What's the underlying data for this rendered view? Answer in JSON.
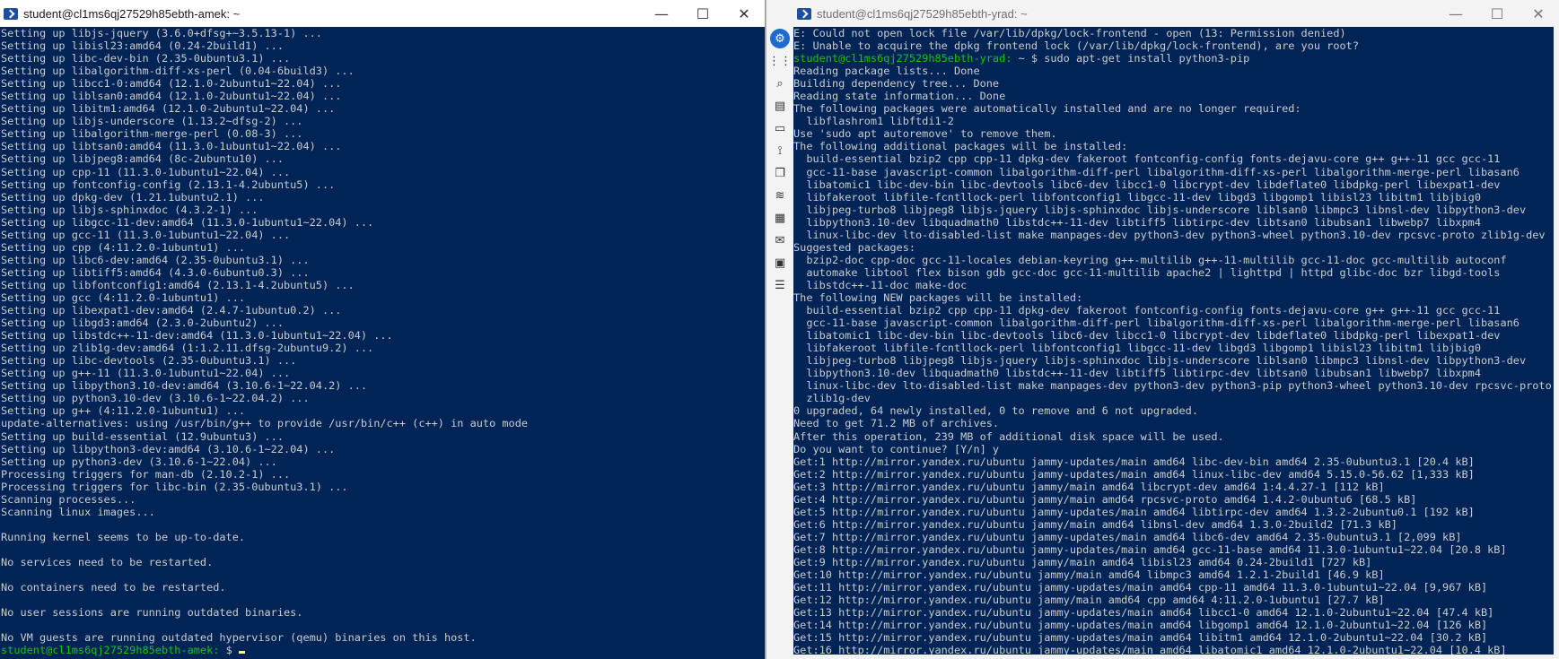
{
  "left_window": {
    "title": "student@cl1ms6qj27529h85ebth-amek: ~",
    "controls": {
      "minimize": "—",
      "maximize": "☐",
      "close": "✕"
    },
    "lines": [
      "Setting up libjs-jquery (3.6.0+dfsg+~3.5.13-1) ...",
      "Setting up libisl23:amd64 (0.24-2build1) ...",
      "Setting up libc-dev-bin (2.35-0ubuntu3.1) ...",
      "Setting up libalgorithm-diff-xs-perl (0.04-6build3) ...",
      "Setting up libcc1-0:amd64 (12.1.0-2ubuntu1~22.04) ...",
      "Setting up liblsan0:amd64 (12.1.0-2ubuntu1~22.04) ...",
      "Setting up libitm1:amd64 (12.1.0-2ubuntu1~22.04) ...",
      "Setting up libjs-underscore (1.13.2~dfsg-2) ...",
      "Setting up libalgorithm-merge-perl (0.08-3) ...",
      "Setting up libtsan0:amd64 (11.3.0-1ubuntu1~22.04) ...",
      "Setting up libjpeg8:amd64 (8c-2ubuntu10) ...",
      "Setting up cpp-11 (11.3.0-1ubuntu1~22.04) ...",
      "Setting up fontconfig-config (2.13.1-4.2ubuntu5) ...",
      "Setting up dpkg-dev (1.21.1ubuntu2.1) ...",
      "Setting up libjs-sphinxdoc (4.3.2-1) ...",
      "Setting up libgcc-11-dev:amd64 (11.3.0-1ubuntu1~22.04) ...",
      "Setting up gcc-11 (11.3.0-1ubuntu1~22.04) ...",
      "Setting up cpp (4:11.2.0-1ubuntu1) ...",
      "Setting up libc6-dev:amd64 (2.35-0ubuntu3.1) ...",
      "Setting up libtiff5:amd64 (4.3.0-6ubuntu0.3) ...",
      "Setting up libfontconfig1:amd64 (2.13.1-4.2ubuntu5) ...",
      "Setting up gcc (4:11.2.0-1ubuntu1) ...",
      "Setting up libexpat1-dev:amd64 (2.4.7-1ubuntu0.2) ...",
      "Setting up libgd3:amd64 (2.3.0-2ubuntu2) ...",
      "Setting up libstdc++-11-dev:amd64 (11.3.0-1ubuntu1~22.04) ...",
      "Setting up zlib1g-dev:amd64 (1:1.2.11.dfsg-2ubuntu9.2) ...",
      "Setting up libc-devtools (2.35-0ubuntu3.1) ...",
      "Setting up g++-11 (11.3.0-1ubuntu1~22.04) ...",
      "Setting up libpython3.10-dev:amd64 (3.10.6-1~22.04.2) ...",
      "Setting up python3.10-dev (3.10.6-1~22.04.2) ...",
      "Setting up g++ (4:11.2.0-1ubuntu1) ...",
      "update-alternatives: using /usr/bin/g++ to provide /usr/bin/c++ (c++) in auto mode",
      "Setting up build-essential (12.9ubuntu3) ...",
      "Setting up libpython3-dev:amd64 (3.10.6-1~22.04) ...",
      "Setting up python3-dev (3.10.6-1~22.04) ...",
      "Processing triggers for man-db (2.10.2-1) ...",
      "Processing triggers for libc-bin (2.35-0ubuntu3.1) ...",
      "Scanning processes...",
      "Scanning linux images...",
      "",
      "Running kernel seems to be up-to-date.",
      "",
      "No services need to be restarted.",
      "",
      "No containers need to be restarted.",
      "",
      "No user sessions are running outdated binaries.",
      "",
      "No VM guests are running outdated hypervisor (qemu) binaries on this host."
    ],
    "prompt": "student@cl1ms6qj27529h85ebth-amek:",
    "prompt_suffix": " $ "
  },
  "right_window": {
    "title": "student@cl1ms6qj27529h85ebth-yrad: ~",
    "controls": {
      "minimize": "—",
      "maximize": "☐",
      "close": "✕"
    },
    "toolbar_icons": [
      "settings-icon",
      "apps-grid-icon",
      "search-icon",
      "server-icon",
      "drive-icon",
      "network-icon",
      "copy-icon",
      "layers-icon",
      "dashboard-icon",
      "chat-icon",
      "image-icon",
      "list-icon"
    ],
    "toolbar_glyphs": [
      "⚙",
      "⋮⋮",
      "⌕",
      "▤",
      "▭",
      "⟟",
      "❐",
      "≋",
      "▦",
      "✉",
      "▣",
      "☰"
    ],
    "prompt": "student@cl1ms6qj27529h85ebth-yrad:",
    "prompt_command": " ~ $ sudo apt-get install python3-pip",
    "lines_before": [
      "E: Could not open lock file /var/lib/dpkg/lock-frontend - open (13: Permission denied)",
      "E: Unable to acquire the dpkg frontend lock (/var/lib/dpkg/lock-frontend), are you root?"
    ],
    "lines_after": [
      "Reading package lists... Done",
      "Building dependency tree... Done",
      "Reading state information... Done",
      "The following packages were automatically installed and are no longer required:",
      "  libflashrom1 libftdi1-2",
      "Use 'sudo apt autoremove' to remove them.",
      "The following additional packages will be installed:",
      "  build-essential bzip2 cpp cpp-11 dpkg-dev fakeroot fontconfig-config fonts-dejavu-core g++ g++-11 gcc gcc-11",
      "  gcc-11-base javascript-common libalgorithm-diff-perl libalgorithm-diff-xs-perl libalgorithm-merge-perl libasan6",
      "  libatomic1 libc-dev-bin libc-devtools libc6-dev libcc1-0 libcrypt-dev libdeflate0 libdpkg-perl libexpat1-dev",
      "  libfakeroot libfile-fcntllock-perl libfontconfig1 libgcc-11-dev libgd3 libgomp1 libisl23 libitm1 libjbig0",
      "  libjpeg-turbo8 libjpeg8 libjs-jquery libjs-sphinxdoc libjs-underscore liblsan0 libmpc3 libnsl-dev libpython3-dev",
      "  libpython3.10-dev libquadmath0 libstdc++-11-dev libtiff5 libtirpc-dev libtsan0 libubsan1 libwebp7 libxpm4",
      "  linux-libc-dev lto-disabled-list make manpages-dev python3-dev python3-wheel python3.10-dev rpcsvc-proto zlib1g-dev",
      "Suggested packages:",
      "  bzip2-doc cpp-doc gcc-11-locales debian-keyring g++-multilib g++-11-multilib gcc-11-doc gcc-multilib autoconf",
      "  automake libtool flex bison gdb gcc-doc gcc-11-multilib apache2 | lighttpd | httpd glibc-doc bzr libgd-tools",
      "  libstdc++-11-doc make-doc",
      "The following NEW packages will be installed:",
      "  build-essential bzip2 cpp cpp-11 dpkg-dev fakeroot fontconfig-config fonts-dejavu-core g++ g++-11 gcc gcc-11",
      "  gcc-11-base javascript-common libalgorithm-diff-perl libalgorithm-diff-xs-perl libalgorithm-merge-perl libasan6",
      "  libatomic1 libc-dev-bin libc-devtools libc6-dev libcc1-0 libcrypt-dev libdeflate0 libdpkg-perl libexpat1-dev",
      "  libfakeroot libfile-fcntllock-perl libfontconfig1 libgcc-11-dev libgd3 libgomp1 libisl23 libitm1 libjbig0",
      "  libjpeg-turbo8 libjpeg8 libjs-jquery libjs-sphinxdoc libjs-underscore liblsan0 libmpc3 libnsl-dev libpython3-dev",
      "  libpython3.10-dev libquadmath0 libstdc++-11-dev libtiff5 libtirpc-dev libtsan0 libubsan1 libwebp7 libxpm4",
      "  linux-libc-dev lto-disabled-list make manpages-dev python3-dev python3-pip python3-wheel python3.10-dev rpcsvc-proto",
      "  zlib1g-dev",
      "0 upgraded, 64 newly installed, 0 to remove and 6 not upgraded.",
      "Need to get 71.2 MB of archives.",
      "After this operation, 239 MB of additional disk space will be used.",
      "Do you want to continue? [Y/n] y",
      "Get:1 http://mirror.yandex.ru/ubuntu jammy-updates/main amd64 libc-dev-bin amd64 2.35-0ubuntu3.1 [20.4 kB]",
      "Get:2 http://mirror.yandex.ru/ubuntu jammy-updates/main amd64 linux-libc-dev amd64 5.15.0-56.62 [1,333 kB]",
      "Get:3 http://mirror.yandex.ru/ubuntu jammy/main amd64 libcrypt-dev amd64 1:4.4.27-1 [112 kB]",
      "Get:4 http://mirror.yandex.ru/ubuntu jammy/main amd64 rpcsvc-proto amd64 1.4.2-0ubuntu6 [68.5 kB]",
      "Get:5 http://mirror.yandex.ru/ubuntu jammy-updates/main amd64 libtirpc-dev amd64 1.3.2-2ubuntu0.1 [192 kB]",
      "Get:6 http://mirror.yandex.ru/ubuntu jammy/main amd64 libnsl-dev amd64 1.3.0-2build2 [71.3 kB]",
      "Get:7 http://mirror.yandex.ru/ubuntu jammy-updates/main amd64 libc6-dev amd64 2.35-0ubuntu3.1 [2,099 kB]",
      "Get:8 http://mirror.yandex.ru/ubuntu jammy-updates/main amd64 gcc-11-base amd64 11.3.0-1ubuntu1~22.04 [20.8 kB]",
      "Get:9 http://mirror.yandex.ru/ubuntu jammy/main amd64 libisl23 amd64 0.24-2build1 [727 kB]",
      "Get:10 http://mirror.yandex.ru/ubuntu jammy/main amd64 libmpc3 amd64 1.2.1-2build1 [46.9 kB]",
      "Get:11 http://mirror.yandex.ru/ubuntu jammy-updates/main amd64 cpp-11 amd64 11.3.0-1ubuntu1~22.04 [9,967 kB]",
      "Get:12 http://mirror.yandex.ru/ubuntu jammy/main amd64 cpp amd64 4:11.2.0-1ubuntu1 [27.7 kB]",
      "Get:13 http://mirror.yandex.ru/ubuntu jammy-updates/main amd64 libcc1-0 amd64 12.1.0-2ubuntu1~22.04 [47.4 kB]",
      "Get:14 http://mirror.yandex.ru/ubuntu jammy-updates/main amd64 libgomp1 amd64 12.1.0-2ubuntu1~22.04 [126 kB]",
      "Get:15 http://mirror.yandex.ru/ubuntu jammy-updates/main amd64 libitm1 amd64 12.1.0-2ubuntu1~22.04 [30.2 kB]",
      "Get:16 http://mirror.yandex.ru/ubuntu jammy-updates/main amd64 libatomic1 amd64 12.1.0-2ubuntu1~22.04 [10.4 kB]"
    ]
  },
  "colors": {
    "terminal_bg": "#012456",
    "terminal_fg": "#cccccc",
    "prompt": "#16c60c",
    "cursor": "#f9f1a5",
    "accent": "#1e6bd0"
  }
}
